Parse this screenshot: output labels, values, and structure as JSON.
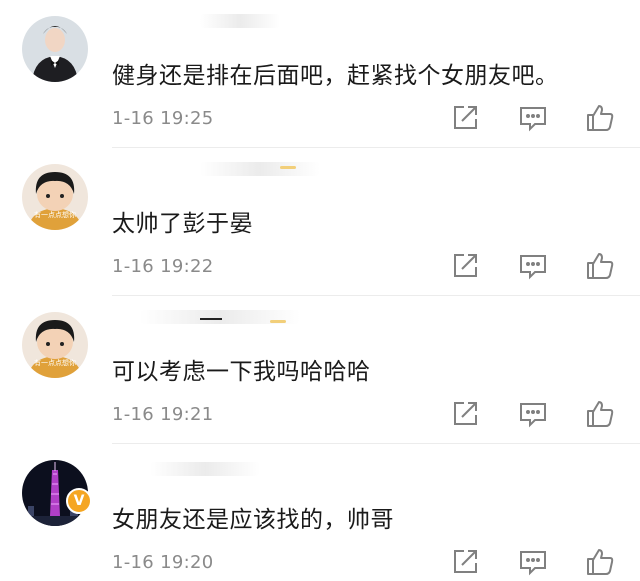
{
  "comments": [
    {
      "text": "健身还是排在后面吧，赶紧找个女朋友吧。",
      "time": "1-16 19:25",
      "avatar": "man-in-tuxedo-avatar",
      "avatar_label": "",
      "verified": false
    },
    {
      "text": "太帅了彭于晏",
      "time": "1-16 19:22",
      "avatar": "child-avatar",
      "avatar_label": "有一点点想你",
      "verified": false
    },
    {
      "text": "可以考虑一下我吗哈哈哈",
      "time": "1-16 19:21",
      "avatar": "child-avatar",
      "avatar_label": "有一点点想你",
      "verified": false
    },
    {
      "text": "女朋友还是应该找的，帅哥",
      "time": "1-16 19:20",
      "avatar": "canton-tower-night-avatar",
      "avatar_label": "",
      "verified": true,
      "verified_mark": "V"
    }
  ],
  "icons": {
    "forward": "forward-icon",
    "reply": "comment-icon",
    "like": "thumbs-up-icon"
  },
  "colors": {
    "text": "#1a1a1a",
    "time": "#8a8a8a",
    "icon": "#808080",
    "verified": "#f5a623",
    "divider": "#ececec"
  }
}
